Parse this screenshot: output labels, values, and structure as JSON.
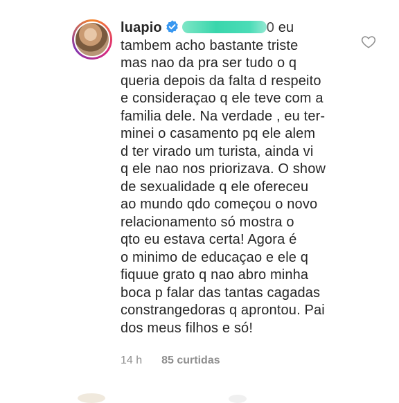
{
  "comment": {
    "username": "luapio",
    "verified_icon": "verified-badge-icon",
    "mention_tail": "0",
    "text_first": " eu",
    "text_rest": "tambem acho bastante triste\nmas nao da pra ser tudo o q\nqueria depois da falta d respeito\ne consideraçao q ele teve com a\nfamilia dele. Na verdade , eu ter-\nminei o casamento pq ele alem\nd ter virado um turista, ainda vi\nq ele nao nos priorizava. O show\nde sexualidade q ele ofereceu\nao mundo qdo começou o novo\nrelacionamento só mostra o\nqto eu estava certa! Agora é\no minimo de educaçao e ele q\nfiquue grato q nao abro minha\nboca p falar das tantas cagadas\nconstrangedoras q aprontou. Pai\ndos meus filhos e só!",
    "time": "14 h",
    "likes": "85 curtidas",
    "like_icon": "heart-outline-icon"
  },
  "colors": {
    "verified_blue": "#3897f0",
    "text": "#262626",
    "meta_gray": "#8e8e8e",
    "redaction": "#39d6ac"
  }
}
